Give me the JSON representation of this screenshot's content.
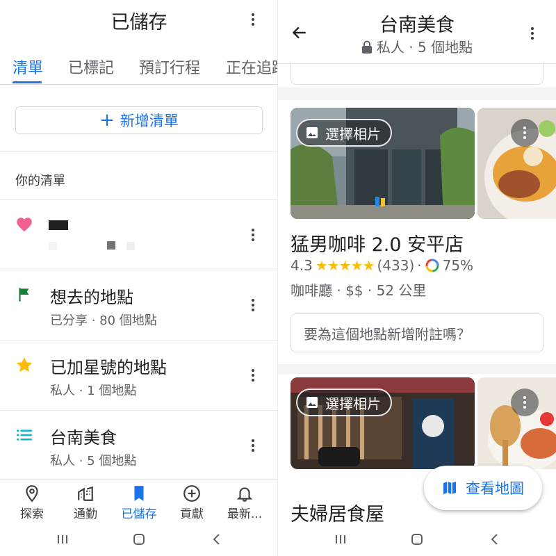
{
  "left": {
    "header": {
      "title": "已儲存"
    },
    "tabs": [
      {
        "label": "清單",
        "active": true
      },
      {
        "label": "已標記",
        "active": false
      },
      {
        "label": "預訂行程",
        "active": false
      },
      {
        "label": "正在追蹤",
        "active": false
      }
    ],
    "new_list_button": {
      "icon": "+",
      "label": "新增清單"
    },
    "section_label": "你的清單",
    "lists": [
      {
        "icon": "heart-icon",
        "name": "",
        "sub": ""
      },
      {
        "icon": "flag-icon",
        "name": "想去的地點",
        "sub": "已分享 · 80 個地點"
      },
      {
        "icon": "star-icon",
        "name": "已加星號的地點",
        "sub": "私人 · 1 個地點"
      },
      {
        "icon": "list-icon",
        "name": "台南美食",
        "sub": "私人 · 5 個地點"
      }
    ],
    "bottom_nav": [
      {
        "icon": "location-pin-icon",
        "label": "探索",
        "active": false
      },
      {
        "icon": "commute-icon",
        "label": "通勤",
        "active": false
      },
      {
        "icon": "bookmark-icon",
        "label": "已儲存",
        "active": true
      },
      {
        "icon": "add-circle-icon",
        "label": "貢獻",
        "active": false
      },
      {
        "icon": "bell-icon",
        "label": "最新...",
        "active": false
      }
    ]
  },
  "right": {
    "header": {
      "title": "台南美食",
      "subtitle": "私人 · 5 個地點"
    },
    "places": [
      {
        "choose_photo_label": "選擇相片",
        "name": "猛男咖啡 2.0 安平店",
        "rating": "4.3",
        "stars": "★★★★★",
        "review_count": "(433)",
        "match_percent": "75%",
        "meta": "咖啡廳 · $$ · 52 公里",
        "note_placeholder": "要為這個地點新增附註嗎？"
      },
      {
        "choose_photo_label": "選擇相片",
        "name": "夫婦居食屋"
      }
    ],
    "fab_label": "查看地圖"
  },
  "colors": {
    "accent": "#1a73e8",
    "heart": "#f06292",
    "flag": "#188038",
    "star": "#fbbc04",
    "list": "#12b5cb"
  }
}
